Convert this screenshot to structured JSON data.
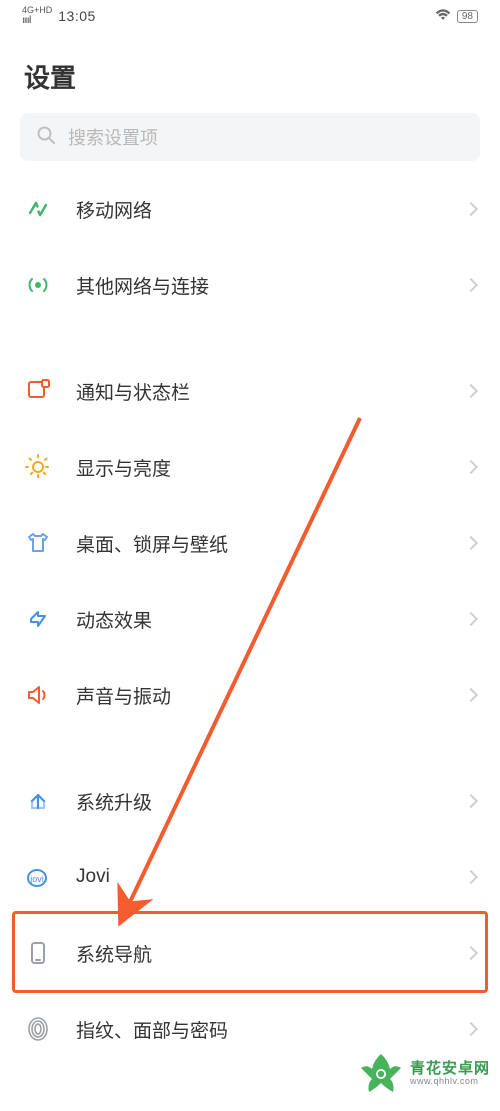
{
  "status": {
    "network_type": "4G+HD",
    "time": "13:05",
    "battery": "98"
  },
  "page_title": "设置",
  "search": {
    "placeholder": "搜索设置项"
  },
  "groups": [
    {
      "items": [
        {
          "id": "mobile-network",
          "label": "移动网络",
          "icon": "mobile-network-icon",
          "icon_color": "#3fb66f"
        },
        {
          "id": "other-connections",
          "label": "其他网络与连接",
          "icon": "broadcast-icon",
          "icon_color": "#3fb66f"
        }
      ]
    },
    {
      "items": [
        {
          "id": "notification-status",
          "label": "通知与状态栏",
          "icon": "notification-icon",
          "icon_color": "#f25c2e"
        },
        {
          "id": "display-brightness",
          "label": "显示与亮度",
          "icon": "sun-icon",
          "icon_color": "#f5a623"
        },
        {
          "id": "wallpaper",
          "label": "桌面、锁屏与壁纸",
          "icon": "shirt-icon",
          "icon_color": "#6aa0e8"
        },
        {
          "id": "effects",
          "label": "动态效果",
          "icon": "effects-icon",
          "icon_color": "#4a90e2"
        },
        {
          "id": "sound",
          "label": "声音与振动",
          "icon": "sound-icon",
          "icon_color": "#f25c2e"
        }
      ]
    },
    {
      "items": [
        {
          "id": "system-update",
          "label": "系统升级",
          "icon": "upgrade-icon",
          "icon_color": "#4a90e2"
        },
        {
          "id": "jovi",
          "label": "Jovi",
          "icon": "jovi-icon",
          "icon_color": "#4a90e2"
        },
        {
          "id": "system-nav",
          "label": "系统导航",
          "icon": "phone-icon",
          "icon_color": "#9aa0a6",
          "highlighted": true
        },
        {
          "id": "fingerprint",
          "label": "指纹、面部与密码",
          "icon": "fingerprint-icon",
          "icon_color": "#9aa0a6"
        }
      ]
    }
  ],
  "watermark": {
    "title": "青花安卓网",
    "url": "www.qhhlv.com"
  },
  "colors": {
    "highlight": "#f25c2e",
    "arrow": "#f25c2e"
  }
}
